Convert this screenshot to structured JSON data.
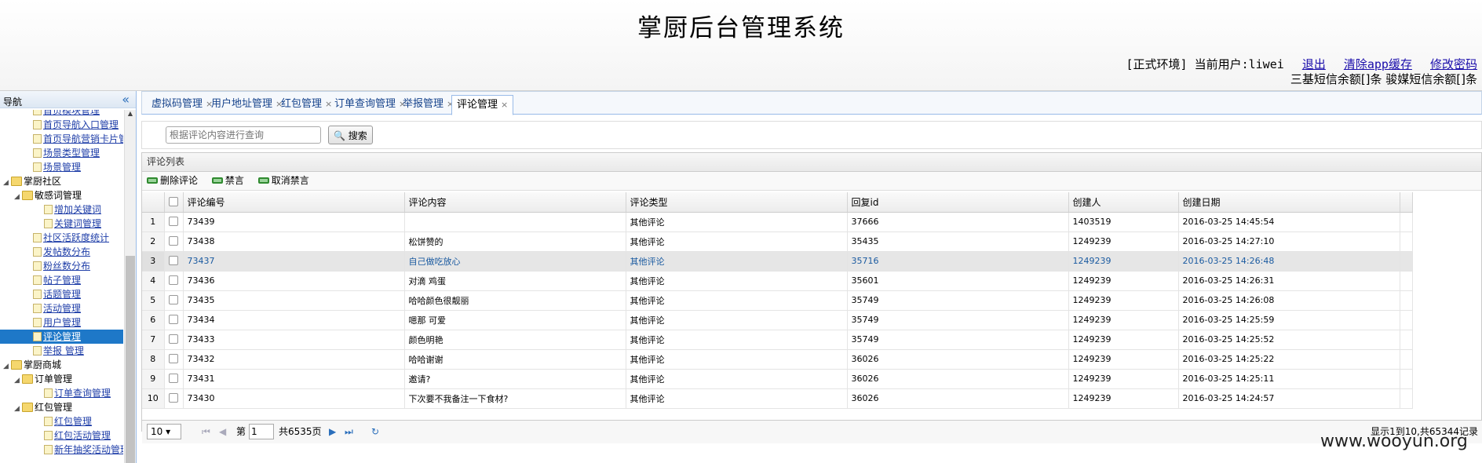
{
  "header": {
    "title": "掌厨后台管理系统",
    "env": "[正式环境]",
    "user_label": "当前用户:liwei",
    "logout": "退出",
    "clear_cache": "清除app缓存",
    "change_pwd": "修改密码",
    "sms": "三基短信余额[]条  骏媒短信余额[]条"
  },
  "sidebar": {
    "title": "导航",
    "collapse_glyph": "«",
    "nodes": [
      {
        "label": "首页模块管理",
        "type": "doc",
        "level": 2,
        "link": true
      },
      {
        "label": "首页导航入口管理",
        "type": "doc",
        "level": 2,
        "link": true
      },
      {
        "label": "首页导航营销卡片管",
        "type": "doc",
        "level": 2,
        "link": true
      },
      {
        "label": "场景类型管理",
        "type": "doc",
        "level": 2,
        "link": true
      },
      {
        "label": "场景管理",
        "type": "doc",
        "level": 2,
        "link": true
      },
      {
        "label": "掌厨社区",
        "type": "folder",
        "level": 0,
        "link": false
      },
      {
        "label": "敏感词管理",
        "type": "folder",
        "level": 1,
        "link": false
      },
      {
        "label": "增加关键词",
        "type": "doc",
        "level": 3,
        "link": true
      },
      {
        "label": "关键词管理",
        "type": "doc",
        "level": 3,
        "link": true
      },
      {
        "label": "社区活跃度统计",
        "type": "doc",
        "level": 2,
        "link": true
      },
      {
        "label": "发帖数分布",
        "type": "doc",
        "level": 2,
        "link": true
      },
      {
        "label": "粉丝数分布",
        "type": "doc",
        "level": 2,
        "link": true
      },
      {
        "label": "帖子管理",
        "type": "doc",
        "level": 2,
        "link": true
      },
      {
        "label": "话题管理",
        "type": "doc",
        "level": 2,
        "link": true
      },
      {
        "label": "活动管理",
        "type": "doc",
        "level": 2,
        "link": true
      },
      {
        "label": "用户管理",
        "type": "doc",
        "level": 2,
        "link": true
      },
      {
        "label": "评论管理",
        "type": "doc",
        "level": 2,
        "link": true,
        "selected": true
      },
      {
        "label": "举报 管理",
        "type": "doc",
        "level": 2,
        "link": true
      },
      {
        "label": "掌厨商城",
        "type": "folder",
        "level": 0,
        "link": false
      },
      {
        "label": "订单管理",
        "type": "folder",
        "level": 1,
        "link": false
      },
      {
        "label": "订单查询管理",
        "type": "doc",
        "level": 3,
        "link": true
      },
      {
        "label": "红包管理",
        "type": "folder",
        "level": 1,
        "link": false
      },
      {
        "label": "红包管理",
        "type": "doc",
        "level": 3,
        "link": true
      },
      {
        "label": "红包活动管理",
        "type": "doc",
        "level": 3,
        "link": true
      },
      {
        "label": "新年抽奖活动管理",
        "type": "doc",
        "level": 3,
        "link": true
      }
    ]
  },
  "tabs": [
    {
      "label": "虚拟码管理"
    },
    {
      "label": "用户地址管理"
    },
    {
      "label": "红包管理"
    },
    {
      "label": "订单查询管理"
    },
    {
      "label": "举报管理"
    },
    {
      "label": "评论管理",
      "active": true
    }
  ],
  "search": {
    "placeholder": "根据评论内容进行查询",
    "button": "搜索"
  },
  "grid": {
    "title": "评论列表",
    "toolbar": {
      "delete": "删除评论",
      "ban": "禁言",
      "unban": "取消禁言"
    },
    "columns": [
      "评论编号",
      "评论内容",
      "评论类型",
      "回复id",
      "创建人",
      "创建日期"
    ],
    "rows": [
      [
        "1",
        "73439",
        "",
        "其他评论",
        "37666",
        "1403519",
        "2016-03-25 14:45:54"
      ],
      [
        "2",
        "73438",
        "松饼赞的",
        "其他评论",
        "35435",
        "1249239",
        "2016-03-25 14:27:10"
      ],
      [
        "3",
        "73437",
        "自己做吃放心",
        "其他评论",
        "35716",
        "1249239",
        "2016-03-25 14:26:48"
      ],
      [
        "4",
        "73436",
        "对滴 鸡蛋",
        "其他评论",
        "35601",
        "1249239",
        "2016-03-25 14:26:31"
      ],
      [
        "5",
        "73435",
        "哈哈颜色很靓丽",
        "其他评论",
        "35749",
        "1249239",
        "2016-03-25 14:26:08"
      ],
      [
        "6",
        "73434",
        "嗯那 可爱",
        "其他评论",
        "35749",
        "1249239",
        "2016-03-25 14:25:59"
      ],
      [
        "7",
        "73433",
        "颜色明艳",
        "其他评论",
        "35749",
        "1249239",
        "2016-03-25 14:25:52"
      ],
      [
        "8",
        "73432",
        "哈哈谢谢",
        "其他评论",
        "36026",
        "1249239",
        "2016-03-25 14:25:22"
      ],
      [
        "9",
        "73431",
        "邀请?",
        "其他评论",
        "36026",
        "1249239",
        "2016-03-25 14:25:11"
      ],
      [
        "10",
        "73430",
        "下次要不我备注一下食材?",
        "其他评论",
        "36026",
        "1249239",
        "2016-03-25 14:24:57"
      ]
    ],
    "highlight_row": 2
  },
  "pager": {
    "page_size": "10",
    "page_prefix": "第",
    "page": "1",
    "page_suffix": "共6535页",
    "info": "显示1到10,共65344记录"
  },
  "watermark": "www.wooyun.org"
}
